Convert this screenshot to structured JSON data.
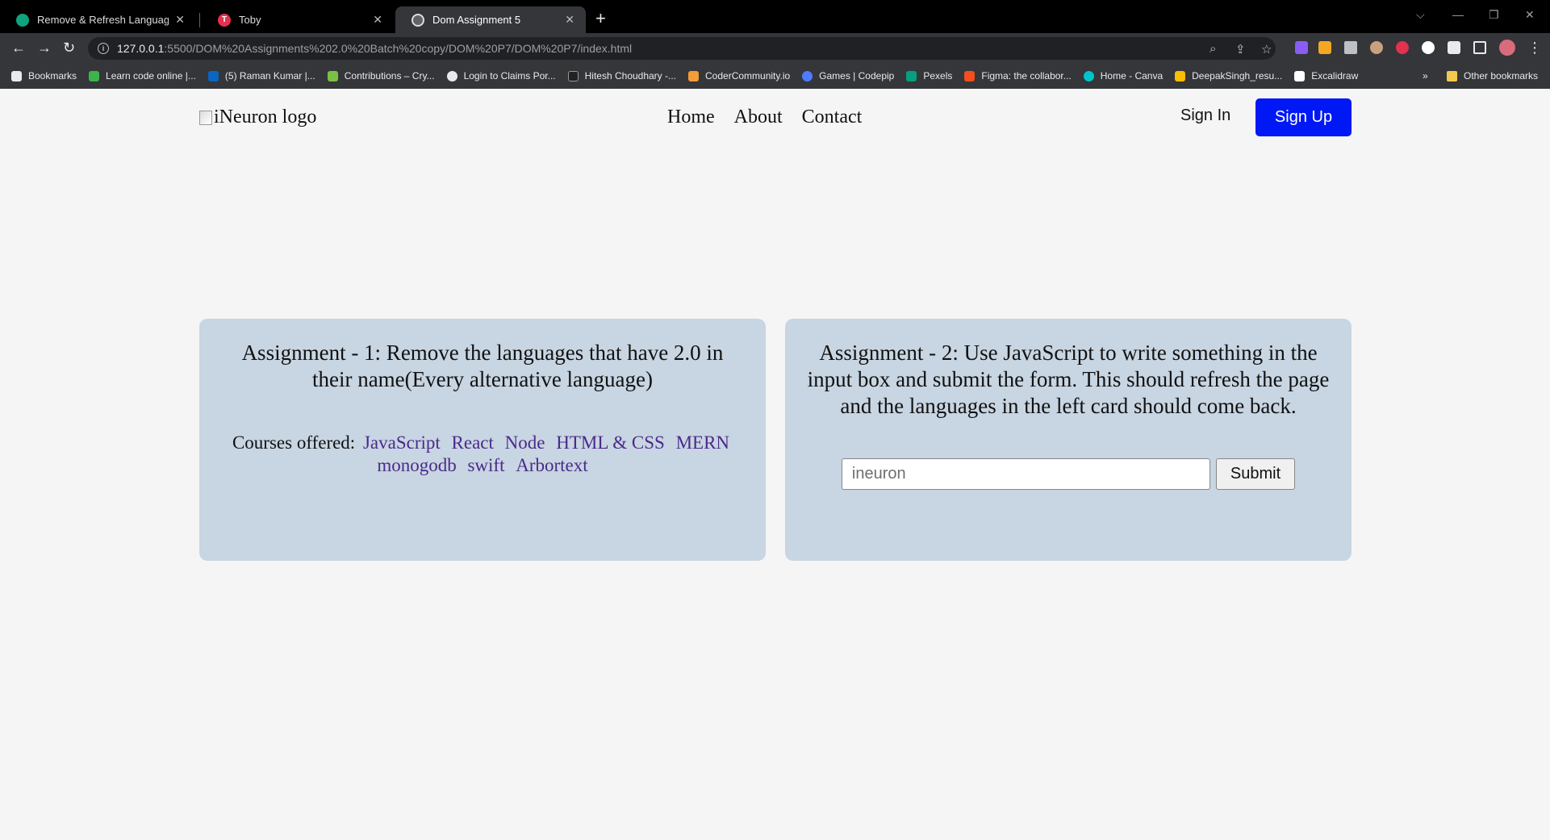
{
  "browser": {
    "tabs": [
      {
        "title": "Remove & Refresh Languages",
        "favicon_color": "#10a37f",
        "active": false
      },
      {
        "title": "Toby",
        "favicon_color": "#e3324e",
        "active": false
      },
      {
        "title": "Dom Assignment 5",
        "favicon_color": "#5f6368",
        "active": true
      }
    ],
    "url_host": "127.0.0.1",
    "url_path": ":5500/DOM%20Assignments%202.0%20Batch%20copy/DOM%20P7/DOM%20P7/index.html",
    "bookmarks": [
      {
        "label": "Bookmarks",
        "color": "#e8eaed"
      },
      {
        "label": "Learn code online |...",
        "color": "#3bb54a"
      },
      {
        "label": "(5) Raman Kumar |...",
        "color": "#0a66c2"
      },
      {
        "label": "Contributions – Cry...",
        "color": "#7ac142"
      },
      {
        "label": "Login to Claims Por...",
        "color": "#e8eaed"
      },
      {
        "label": "Hitesh Choudhary -...",
        "color": "#222222"
      },
      {
        "label": "CoderCommunity.io",
        "color": "#f29d38"
      },
      {
        "label": "Games | Codepip",
        "color": "#4f7cff"
      },
      {
        "label": "Pexels",
        "color": "#05a081"
      },
      {
        "label": "Figma: the collabor...",
        "color": "#f24e1e"
      },
      {
        "label": "Home - Canva",
        "color": "#00c4cc"
      },
      {
        "label": "DeepakSingh_resu...",
        "color": "#fbbc04"
      },
      {
        "label": "Excalidraw",
        "color": "#ffffff"
      }
    ],
    "more_bookmarks": "»",
    "other_bookmarks": "Other bookmarks"
  },
  "page": {
    "logo_alt": "iNeuron logo",
    "nav": [
      "Home",
      "About",
      "Contact"
    ],
    "sign_in": "Sign In",
    "sign_up": "Sign Up",
    "card1": {
      "heading": "Assignment - 1: Remove the languages that have 2.0 in their name(Every alternative language)",
      "courses_label": "Courses offered:",
      "languages": [
        "JavaScript",
        "React",
        "Node",
        "HTML & CSS",
        "MERN",
        "monogodb",
        "swift",
        "Arbortext"
      ]
    },
    "card2": {
      "heading": "Assignment - 2: Use JavaScript to write something in the input box and submit the form. This should refresh the page and the languages in the left card should come back.",
      "input_placeholder": "ineuron",
      "submit": "Submit"
    }
  },
  "colors": {
    "signup_bg": "#0018f5",
    "card_bg": "#c8d5e2",
    "language_link": "#4a2a8a"
  }
}
